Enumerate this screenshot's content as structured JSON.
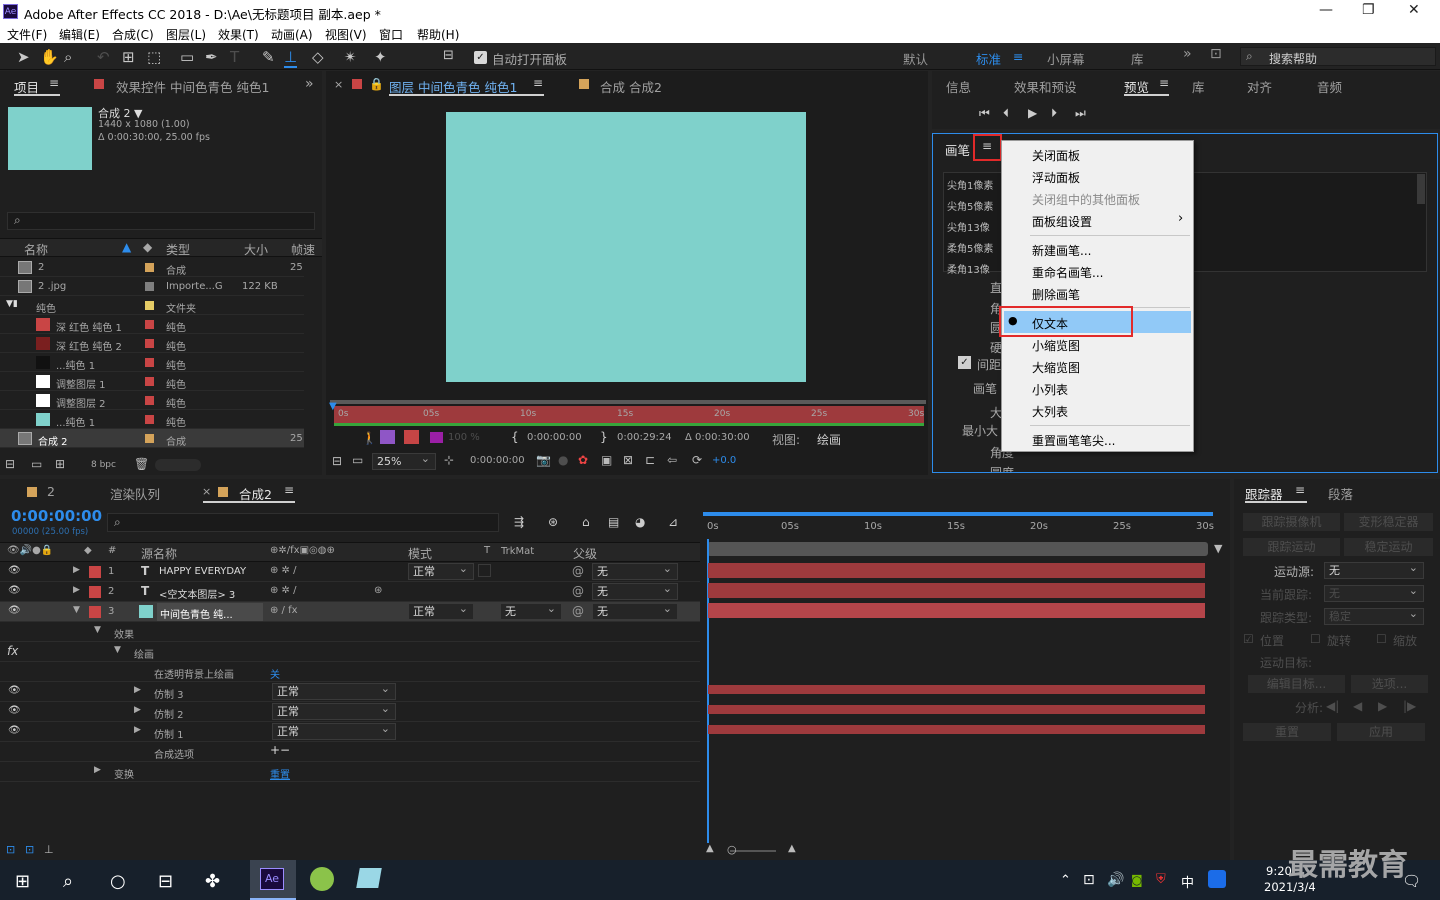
{
  "window": {
    "title": "Adobe After Effects CC 2018 - D:\\Ae\\无标题项目 副本.aep *",
    "app_icon": "Ae"
  },
  "menu": [
    "文件(F)",
    "编辑(E)",
    "合成(C)",
    "图层(L)",
    "效果(T)",
    "动画(A)",
    "视图(V)",
    "窗口",
    "帮助(H)"
  ],
  "toolbar": {
    "auto_open": "自动打开面板",
    "workspaces": [
      "默认",
      "标准",
      "小屏幕",
      "库"
    ],
    "search_placeholder": "搜索帮助"
  },
  "project": {
    "tabs": [
      "项目",
      "效果控件 中间色青色 纯色1"
    ],
    "comp_name": "合成 2 ▼",
    "comp_info1": "1440 x 1080 (1.00)",
    "comp_info2": "Δ 0:00:30:00, 25.00 fps",
    "cols": [
      "名称",
      "类型",
      "大小",
      "帧速"
    ],
    "rows": [
      {
        "name": "2",
        "type": "合成",
        "size": "",
        "fps": "25",
        "color": "#d4a35a"
      },
      {
        "name": "2 .jpg",
        "type": "Importe...G",
        "size": "122 KB",
        "fps": "",
        "color": "#7f7f7f"
      },
      {
        "name": "纯色",
        "type": "文件夹",
        "size": "",
        "fps": "",
        "color": "#e5cc66"
      },
      {
        "name": "深 红色 纯色 1",
        "type": "纯色",
        "size": "",
        "fps": "",
        "color": "#c94545"
      },
      {
        "name": "深 红色 纯色 2",
        "type": "纯色",
        "size": "",
        "fps": "",
        "color": "#c94545"
      },
      {
        "name": "...纯色 1",
        "type": "纯色",
        "size": "",
        "fps": "",
        "color": "#c94545"
      },
      {
        "name": "调整图层 1",
        "type": "纯色",
        "size": "",
        "fps": "",
        "color": "#c94545"
      },
      {
        "name": "调整图层 2",
        "type": "纯色",
        "size": "",
        "fps": "",
        "color": "#c94545"
      },
      {
        "name": "...纯色 1",
        "type": "纯色",
        "size": "",
        "fps": "",
        "color": "#c94545"
      },
      {
        "name": "合成 2",
        "type": "合成",
        "size": "",
        "fps": "25",
        "color": "#d4a35a"
      }
    ],
    "bpc": "8 bpc"
  },
  "viewer": {
    "tabs": [
      "图层 中间色青色 纯色1",
      "合成 合成2"
    ],
    "ruler": [
      "0s",
      "05s",
      "10s",
      "15s",
      "20s",
      "25s",
      "30s"
    ],
    "pct": "100 %",
    "t_in": "0:00:00:00",
    "t_out": "0:00:29:24",
    "t_dur": "Δ 0:00:30:00",
    "view_label": "视图:",
    "view_val": "绘画",
    "zoom": "25%",
    "time": "0:00:00:00",
    "exposure": "+0.0"
  },
  "right": {
    "tabs": [
      "信息",
      "效果和预设",
      "预览",
      "库",
      "对齐",
      "音频"
    ],
    "brush_title": "画笔",
    "brush_rows": [
      "尖角1像素",
      "尖角5像素",
      "尖角13像",
      "柔角5像素",
      "柔角13像"
    ],
    "checkbox_label": "间距",
    "labels": [
      "直",
      "角",
      "圆",
      "硬",
      "画笔",
      "大",
      "最小大",
      "角度",
      "圆度"
    ]
  },
  "context_menu": {
    "items": [
      "关闭面板",
      "浮动面板",
      "关闭组中的其他面板",
      "面板组设置",
      "新建画笔...",
      "重命名画笔...",
      "删除画笔",
      "仅文本",
      "小缩览图",
      "大缩览图",
      "小列表",
      "大列表",
      "重置画笔笔尖..."
    ],
    "selected": "仅文本"
  },
  "timeline": {
    "tabs": [
      "2",
      "渲染队列",
      "合成2"
    ],
    "time": "0:00:00:00",
    "frames": "00000 (25.00 fps)",
    "headers": [
      "源名称",
      "模式",
      "T",
      "TrkMat",
      "父级"
    ],
    "ruler": [
      "0s",
      "05s",
      "10s",
      "15s",
      "20s",
      "25s",
      "30s"
    ],
    "layers": [
      {
        "num": "1",
        "name": "HAPPY EVERYDAY",
        "mode": "正常",
        "parent": "无",
        "color": "#c94545"
      },
      {
        "num": "2",
        "name": "<空文本图层> 3",
        "mode": "",
        "parent": "无",
        "color": "#c94545"
      },
      {
        "num": "3",
        "name": "中间色青色 纯...",
        "mode": "正常",
        "trkmat": "无",
        "parent": "无",
        "color": "#c94545"
      }
    ],
    "sub": {
      "effects": "效果",
      "paint": "绘画",
      "on_transparent": "在透明背景上绘画",
      "off": "关",
      "clone3": "仿制 3",
      "clone2": "仿制 2",
      "clone1": "仿制 1",
      "normal": "正常",
      "comp_opts": "合成选项",
      "transform": "变换",
      "reset": "重置"
    }
  },
  "tracker": {
    "tabs": [
      "跟踪器",
      "段落"
    ],
    "btns": [
      "跟踪摄像机",
      "变形稳定器",
      "跟踪运动",
      "稳定运动"
    ],
    "motion_source_label": "运动源:",
    "motion_source": "无",
    "current_track_label": "当前跟踪:",
    "current_track": "无",
    "track_type_label": "跟踪类型:",
    "track_type": "稳定",
    "checks": [
      "位置",
      "旋转",
      "缩放"
    ],
    "motion_target": "运动目标:",
    "edit_target": "编辑目标...",
    "options": "选项...",
    "analyze": "分析:",
    "reset": "重置",
    "apply": "应用"
  },
  "taskbar": {
    "time": "9:20",
    "date": "2021/3/4",
    "ime": "中",
    "watermark": "最需教育"
  },
  "colors": {
    "accent": "#2d8ceb",
    "solid": "#7fd1cb",
    "layer_bar": "#9e3a3d",
    "highlight": "#e22a2a"
  }
}
